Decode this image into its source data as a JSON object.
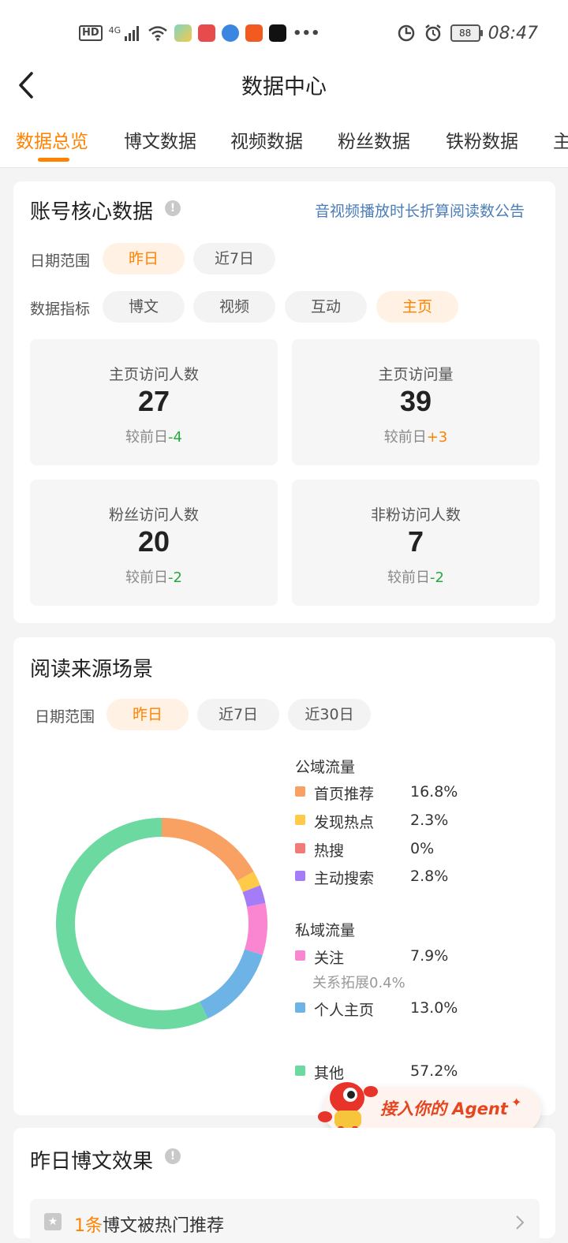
{
  "status_bar": {
    "left_text": "HD",
    "network": "4G",
    "time": "08:47",
    "battery": "88",
    "icons": [
      "hd-icon",
      "signal-icon",
      "wifi-icon",
      "app-icon",
      "app-icon",
      "app-icon",
      "app-icon",
      "tiktok-icon",
      "more-icon"
    ],
    "right_icons": [
      "data-saver-icon",
      "alarm-icon",
      "battery-icon"
    ]
  },
  "header": {
    "title": "数据中心",
    "back_icon": "chevron-left-icon"
  },
  "tabs": [
    {
      "label": "数据总览",
      "active": true
    },
    {
      "label": "博文数据"
    },
    {
      "label": "视频数据"
    },
    {
      "label": "粉丝数据"
    },
    {
      "label": "铁粉数据"
    },
    {
      "label": "主"
    }
  ],
  "core": {
    "title": "账号核心数据",
    "notice_link": "音视频播放时长折算阅读数公告",
    "date_label": "日期范围",
    "date_options": [
      "昨日",
      "近7日"
    ],
    "metric_label": "数据指标",
    "metric_options": [
      "博文",
      "视频",
      "互动",
      "主页"
    ],
    "stats": [
      {
        "label": "主页访问人数",
        "value": "27",
        "cmp_prefix": "较前日",
        "cmp_delta": "-4"
      },
      {
        "label": "主页访问量",
        "value": "39",
        "cmp_prefix": "较前日",
        "cmp_delta": "+3"
      },
      {
        "label": "粉丝访问人数",
        "value": "20",
        "cmp_prefix": "较前日",
        "cmp_delta": "-2"
      },
      {
        "label": "非粉访问人数",
        "value": "7",
        "cmp_prefix": "较前日",
        "cmp_delta": "-2"
      }
    ]
  },
  "source": {
    "title": "阅读来源场景",
    "date_label": "日期范围",
    "date_options": [
      "昨日",
      "近7日",
      "近30日"
    ],
    "public_title": "公域流量",
    "private_title": "私域流量",
    "relation_note": "关系拓展0.4%"
  },
  "chart_data": {
    "type": "pie",
    "donut": true,
    "legend_placement": "right",
    "series": [
      {
        "name": "首页推荐",
        "value": 16.8,
        "label": "16.8%",
        "group": "公域流量",
        "color": "#f9a063"
      },
      {
        "name": "发现热点",
        "value": 2.3,
        "label": "2.3%",
        "group": "公域流量",
        "color": "#ffc94a"
      },
      {
        "name": "热搜",
        "value": 0,
        "label": "0%",
        "group": "公域流量",
        "color": "#f47a7a"
      },
      {
        "name": "主动搜索",
        "value": 2.8,
        "label": "2.8%",
        "group": "公域流量",
        "color": "#a57cf7"
      },
      {
        "name": "关注",
        "value": 7.9,
        "label": "7.9%",
        "group": "私域流量",
        "color": "#fa86d2"
      },
      {
        "name": "个人主页",
        "value": 13.0,
        "label": "13.0%",
        "group": "私域流量",
        "color": "#6db3e6"
      },
      {
        "name": "其他",
        "value": 57.2,
        "label": "57.2%",
        "group": "",
        "color": "#6cd9a0"
      }
    ]
  },
  "agent_banner": {
    "text": "接入你的 Agent"
  },
  "yesterday": {
    "title": "昨日博文效果",
    "hot_count": "1条",
    "hot_text": "博文被热门推荐"
  },
  "colors": {
    "accent": "#ff8200",
    "link": "#4b7db8",
    "down": "#27a83a"
  }
}
